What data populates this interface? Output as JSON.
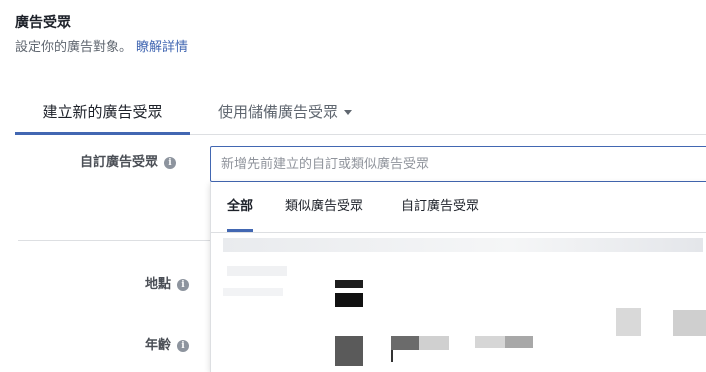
{
  "header": {
    "title": "廣告受眾",
    "description": "設定你的廣告對象。",
    "learn_more": "瞭解詳情"
  },
  "tabs": {
    "create_new": "建立新的廣告受眾",
    "use_saved": "使用儲備廣告受眾"
  },
  "form": {
    "custom_audience_label": "自訂廣告受眾",
    "search_placeholder": "新增先前建立的自訂或類似廣告受眾",
    "location_label": "地點",
    "age_label": "年齡"
  },
  "dropdown": {
    "tabs": [
      "全部",
      "類似廣告受眾",
      "自訂廣告受眾"
    ],
    "active_tab": "全部"
  },
  "colors": {
    "accent": "#4267b2",
    "text": "#1d2129",
    "muted": "#606770",
    "border": "#dddfe2"
  }
}
